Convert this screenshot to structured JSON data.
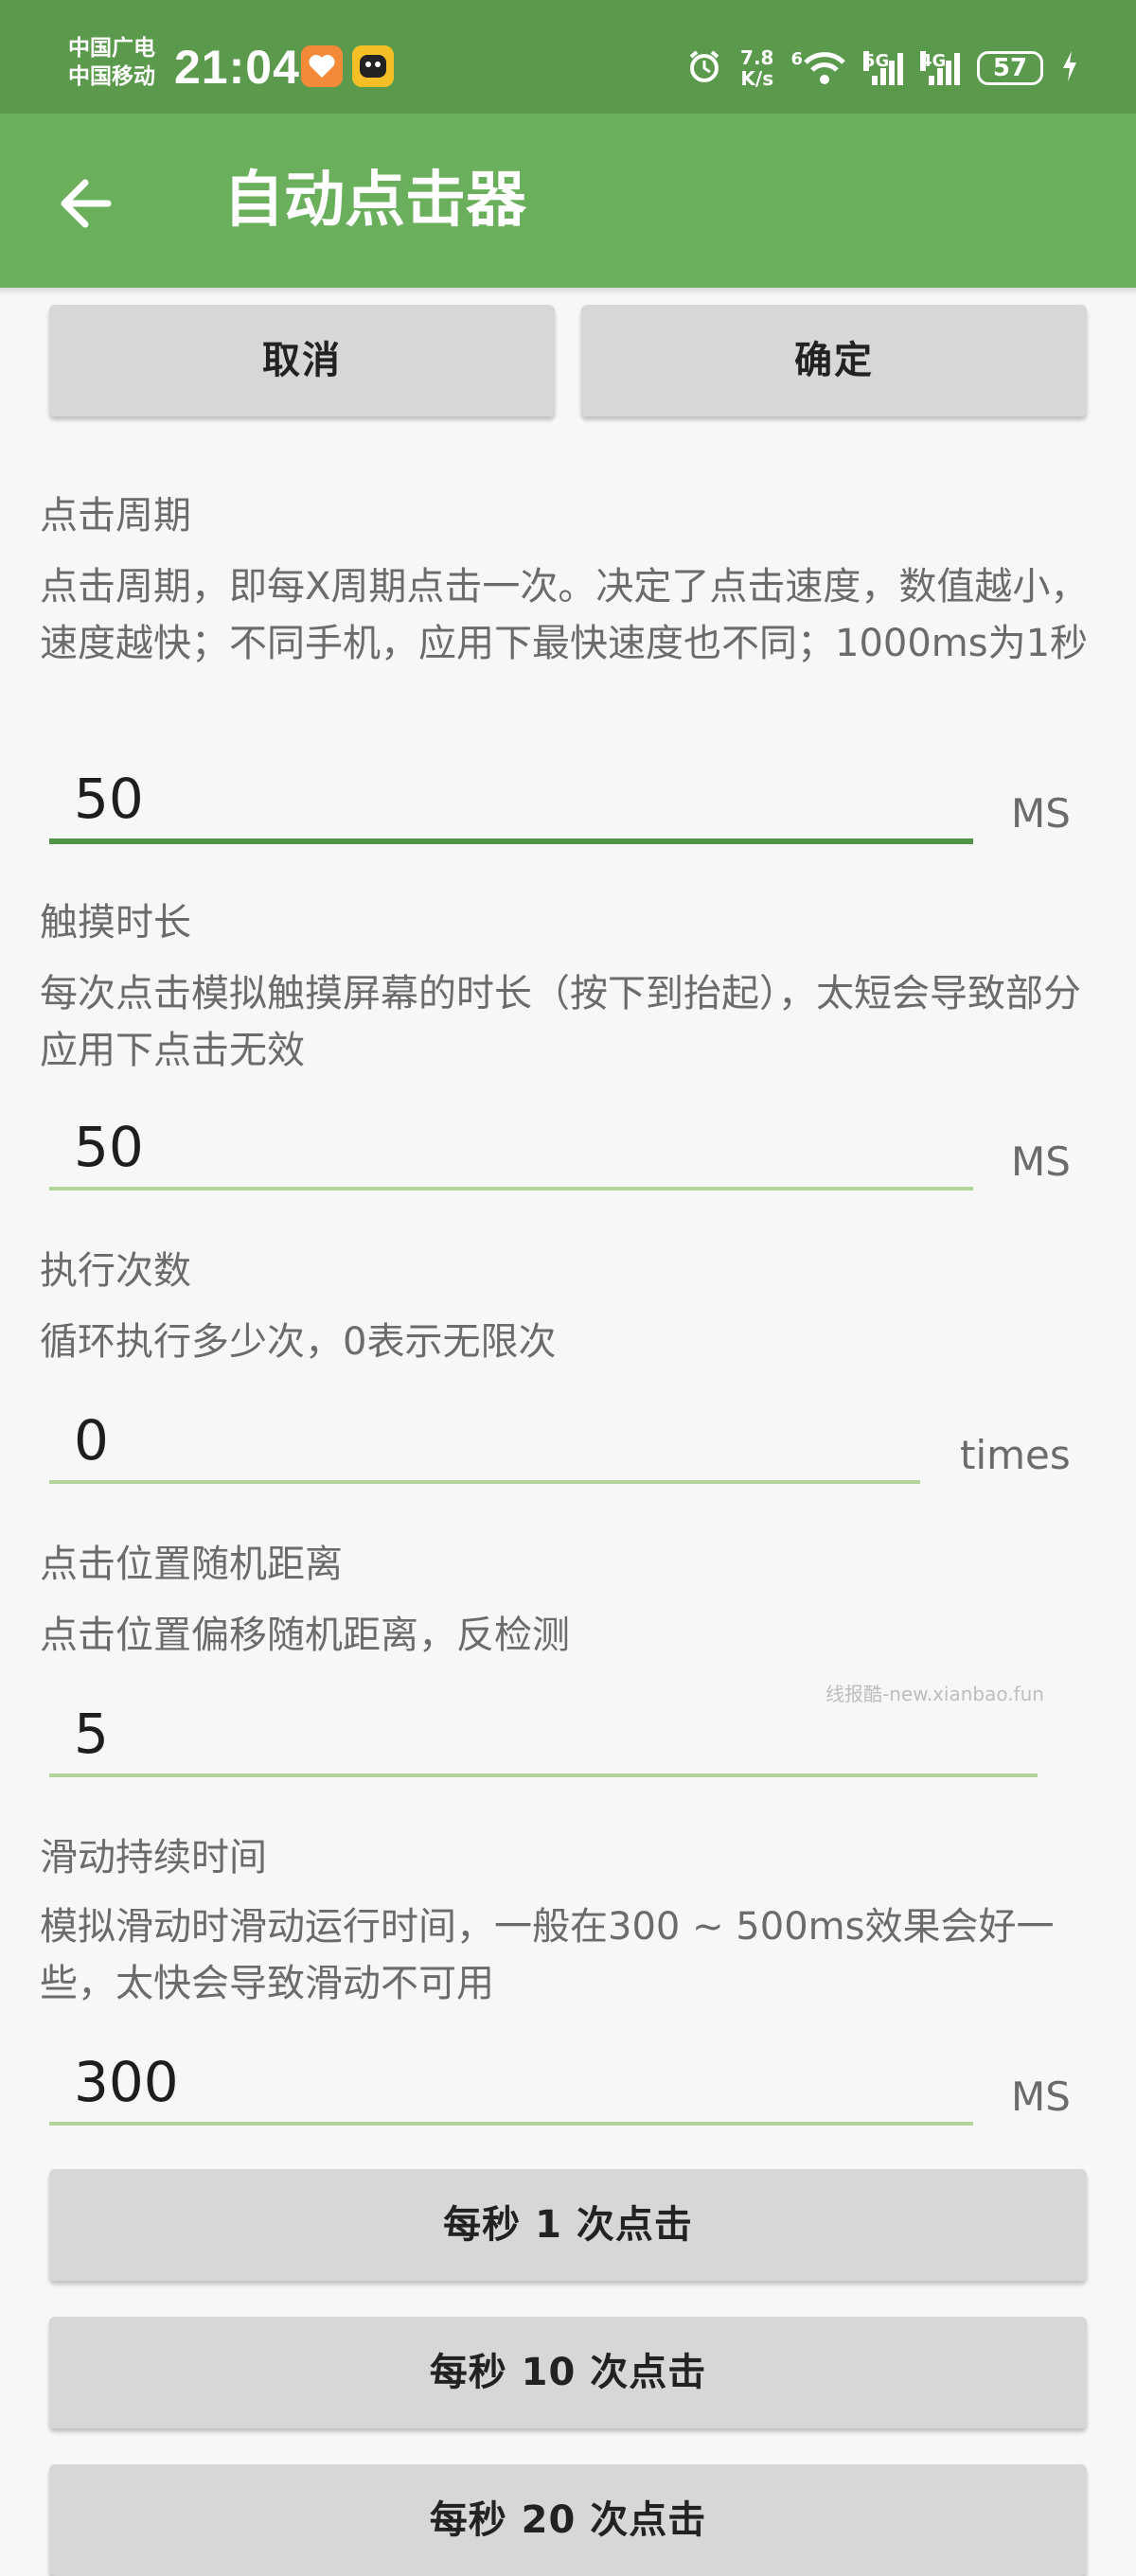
{
  "status_bar": {
    "carrier1": "中国广电",
    "carrier2": "中国移动",
    "time": "21:04",
    "net_speed_value": "7.8",
    "net_speed_unit": "K/s",
    "wifi_label": "6",
    "sig1_label": "5G",
    "sig2_label": "4G",
    "battery": "57"
  },
  "app_bar": {
    "title": "自动点击器"
  },
  "actions": {
    "cancel": "取消",
    "confirm": "确定"
  },
  "settings": [
    {
      "label": "点击周期",
      "desc": "点击周期，即每X周期点击一次。决定了点击速度，数值越小，速度越快；不同手机，应用下最快速度也不同；1000ms为1秒",
      "value": "50",
      "unit": "MS"
    },
    {
      "label": "触摸时长",
      "desc": "每次点击模拟触摸屏幕的时长（按下到抬起），太短会导致部分应用下点击无效",
      "value": "50",
      "unit": "MS"
    },
    {
      "label": "执行次数",
      "desc": "循环执行多少次，0表示无限次",
      "value": "0",
      "unit": "times"
    },
    {
      "label": "点击位置随机距离",
      "desc": "点击位置偏移随机距离，反检测",
      "value": "5",
      "unit": ""
    },
    {
      "label": "滑动持续时间",
      "desc": "模拟滑动时滑动运行时间，一般在300 ~ 500ms效果会好一些，太快会导致滑动不可用",
      "value": "300",
      "unit": "MS"
    }
  ],
  "presets": [
    "每秒 1 次点击",
    "每秒 10 次点击",
    "每秒 20 次点击"
  ],
  "watermark": "线报酷-new.xianbao.fun",
  "colors": {
    "status_bar": "#5b9a4c",
    "app_bar": "#6aaf5b",
    "field_active": "#4f9444",
    "field_inactive": "#b2d49a"
  }
}
